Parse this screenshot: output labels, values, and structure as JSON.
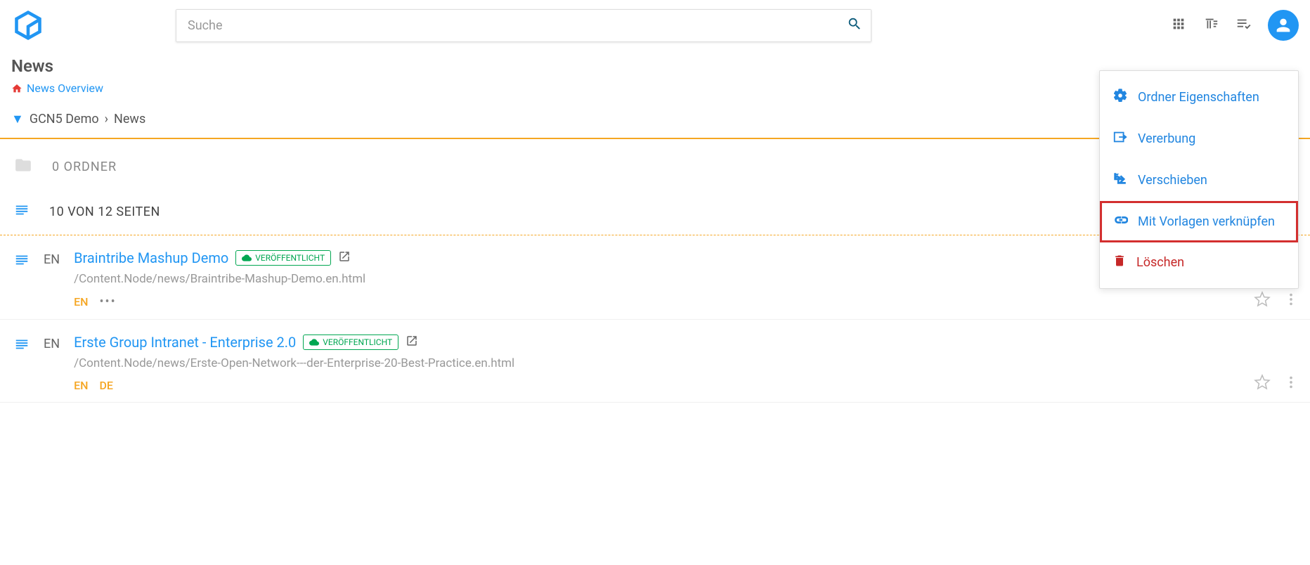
{
  "search": {
    "placeholder": "Suche"
  },
  "header": {
    "title": "News",
    "overview_link": "News Overview"
  },
  "breadcrumb": {
    "root": "GCN5 Demo",
    "current": "News"
  },
  "sections": {
    "folders_label": "0 ORDNER",
    "pages_label": "10 VON 12 SEITEN"
  },
  "pages": [
    {
      "lang": "EN",
      "name": "Braintribe Mashup Demo",
      "status": "VERÖFFENTLICHT",
      "path": "/Content.Node/news/Braintribe-Mashup-Demo.en.html",
      "langs": [
        "EN"
      ],
      "more": true
    },
    {
      "lang": "EN",
      "name": "Erste Group Intranet - Enterprise 2.0",
      "status": "VERÖFFENTLICHT",
      "path": "/Content.Node/news/Erste-Open-Network---der-Enterprise-20-Best-Practice.en.html",
      "langs": [
        "EN",
        "DE"
      ],
      "more": false
    }
  ],
  "context_menu": [
    {
      "label": "Ordner Eigenschaften",
      "icon": "gear",
      "style": "blue",
      "highlighted": false
    },
    {
      "label": "Vererbung",
      "icon": "arrow-in",
      "style": "blue",
      "highlighted": false
    },
    {
      "label": "Verschieben",
      "icon": "subdir-arrow",
      "style": "blue",
      "highlighted": false
    },
    {
      "label": "Mit Vorlagen verknüpfen",
      "icon": "link",
      "style": "blue",
      "highlighted": true
    },
    {
      "label": "Löschen",
      "icon": "trash",
      "style": "red",
      "highlighted": false
    }
  ]
}
